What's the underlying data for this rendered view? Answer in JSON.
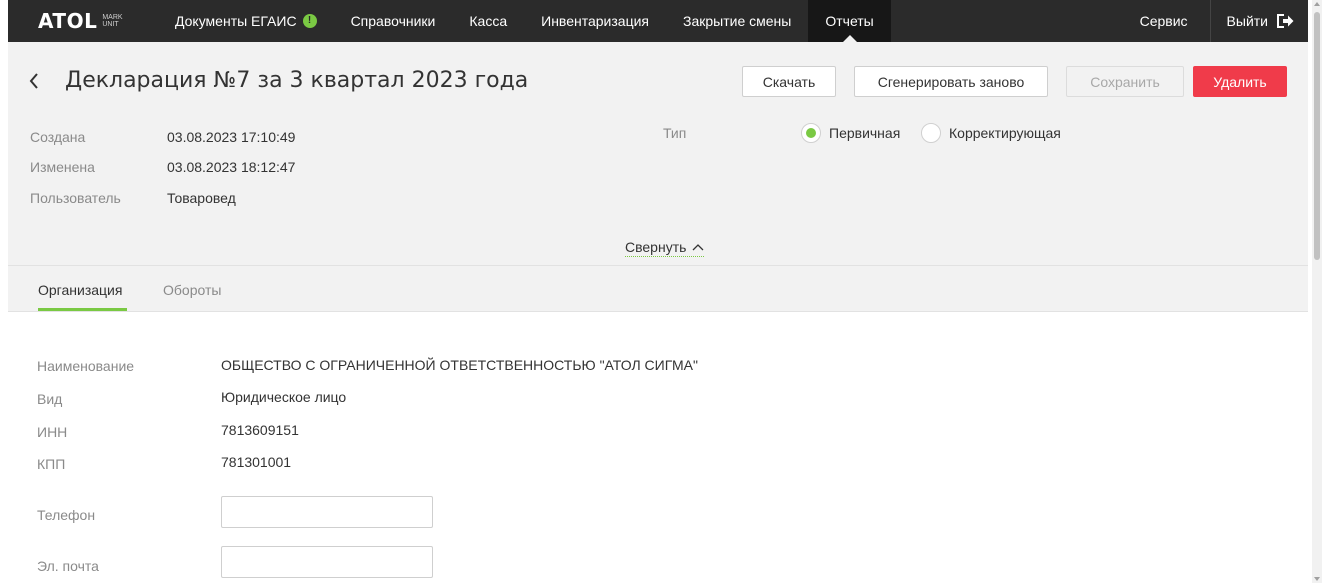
{
  "navbar": {
    "logo_text": "ATOL",
    "logo_sub": "MARK UNIT",
    "items": [
      {
        "label": "Документы ЕГАИС",
        "badge": "!"
      },
      {
        "label": "Справочники"
      },
      {
        "label": "Касса"
      },
      {
        "label": "Инвентаризация"
      },
      {
        "label": "Закрытие смены"
      },
      {
        "label": "Отчеты",
        "active": true
      }
    ],
    "service_label": "Сервис",
    "logout_label": "Выйти"
  },
  "header": {
    "title": "Декларация №7 за 3 квартал 2023 года",
    "buttons": {
      "download": "Скачать",
      "regenerate": "Сгенерировать заново",
      "save": "Сохранить",
      "delete": "Удалить"
    },
    "meta": {
      "created_label": "Создана",
      "created_value": "03.08.2023 17:10:49",
      "modified_label": "Изменена",
      "modified_value": "03.08.2023 18:12:47",
      "user_label": "Пользователь",
      "user_value": "Товаровед"
    },
    "type": {
      "label": "Тип",
      "options": [
        {
          "label": "Первичная",
          "selected": true
        },
        {
          "label": "Корректирующая",
          "selected": false
        }
      ]
    },
    "collapse_label": "Свернуть"
  },
  "tabs": [
    {
      "label": "Организация",
      "active": true
    },
    {
      "label": "Обороты",
      "active": false
    }
  ],
  "organization": {
    "name_label": "Наименование",
    "name_value": "ОБЩЕСТВО С ОГРАНИЧЕННОЙ ОТВЕТСТВЕННОСТЬЮ \"АТОЛ СИГМА\"",
    "kind_label": "Вид",
    "kind_value": "Юридическое лицо",
    "inn_label": "ИНН",
    "inn_value": "7813609151",
    "kpp_label": "КПП",
    "kpp_value": "781301001",
    "phone_label": "Телефон",
    "phone_value": "",
    "email_label": "Эл. почта",
    "email_value": ""
  },
  "colors": {
    "accent_green": "#7ac943",
    "delete_red": "#f03b4a",
    "navbar_bg": "#2b2b2b"
  }
}
